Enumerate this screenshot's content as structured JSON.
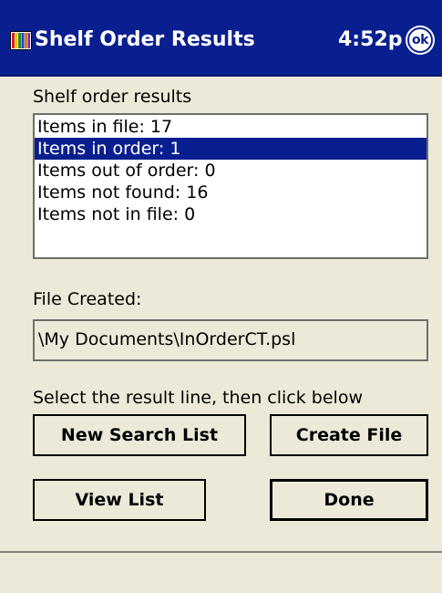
{
  "title_bar": {
    "app_icon": "shelf-order-app-icon",
    "title": "Shelf Order Results",
    "clock": "4:52p",
    "ok_label": "ok"
  },
  "results": {
    "label": "Shelf order results",
    "items": [
      "Items in file: 17",
      "Items in order: 1",
      "Items out of order: 0",
      "Items not found: 16",
      "Items not in file: 0"
    ],
    "selected_index": 1
  },
  "file": {
    "label": "File Created:",
    "path": "\\My Documents\\InOrderCT.psl"
  },
  "instructions": "Select the result line, then click below",
  "buttons": {
    "new_search_list": "New Search List",
    "create_file": "Create File",
    "view_list": "View List",
    "done": "Done"
  },
  "colors": {
    "title_bar": "#0a1f8f",
    "selection": "#0a1f8f",
    "background": "#ece9d8"
  }
}
